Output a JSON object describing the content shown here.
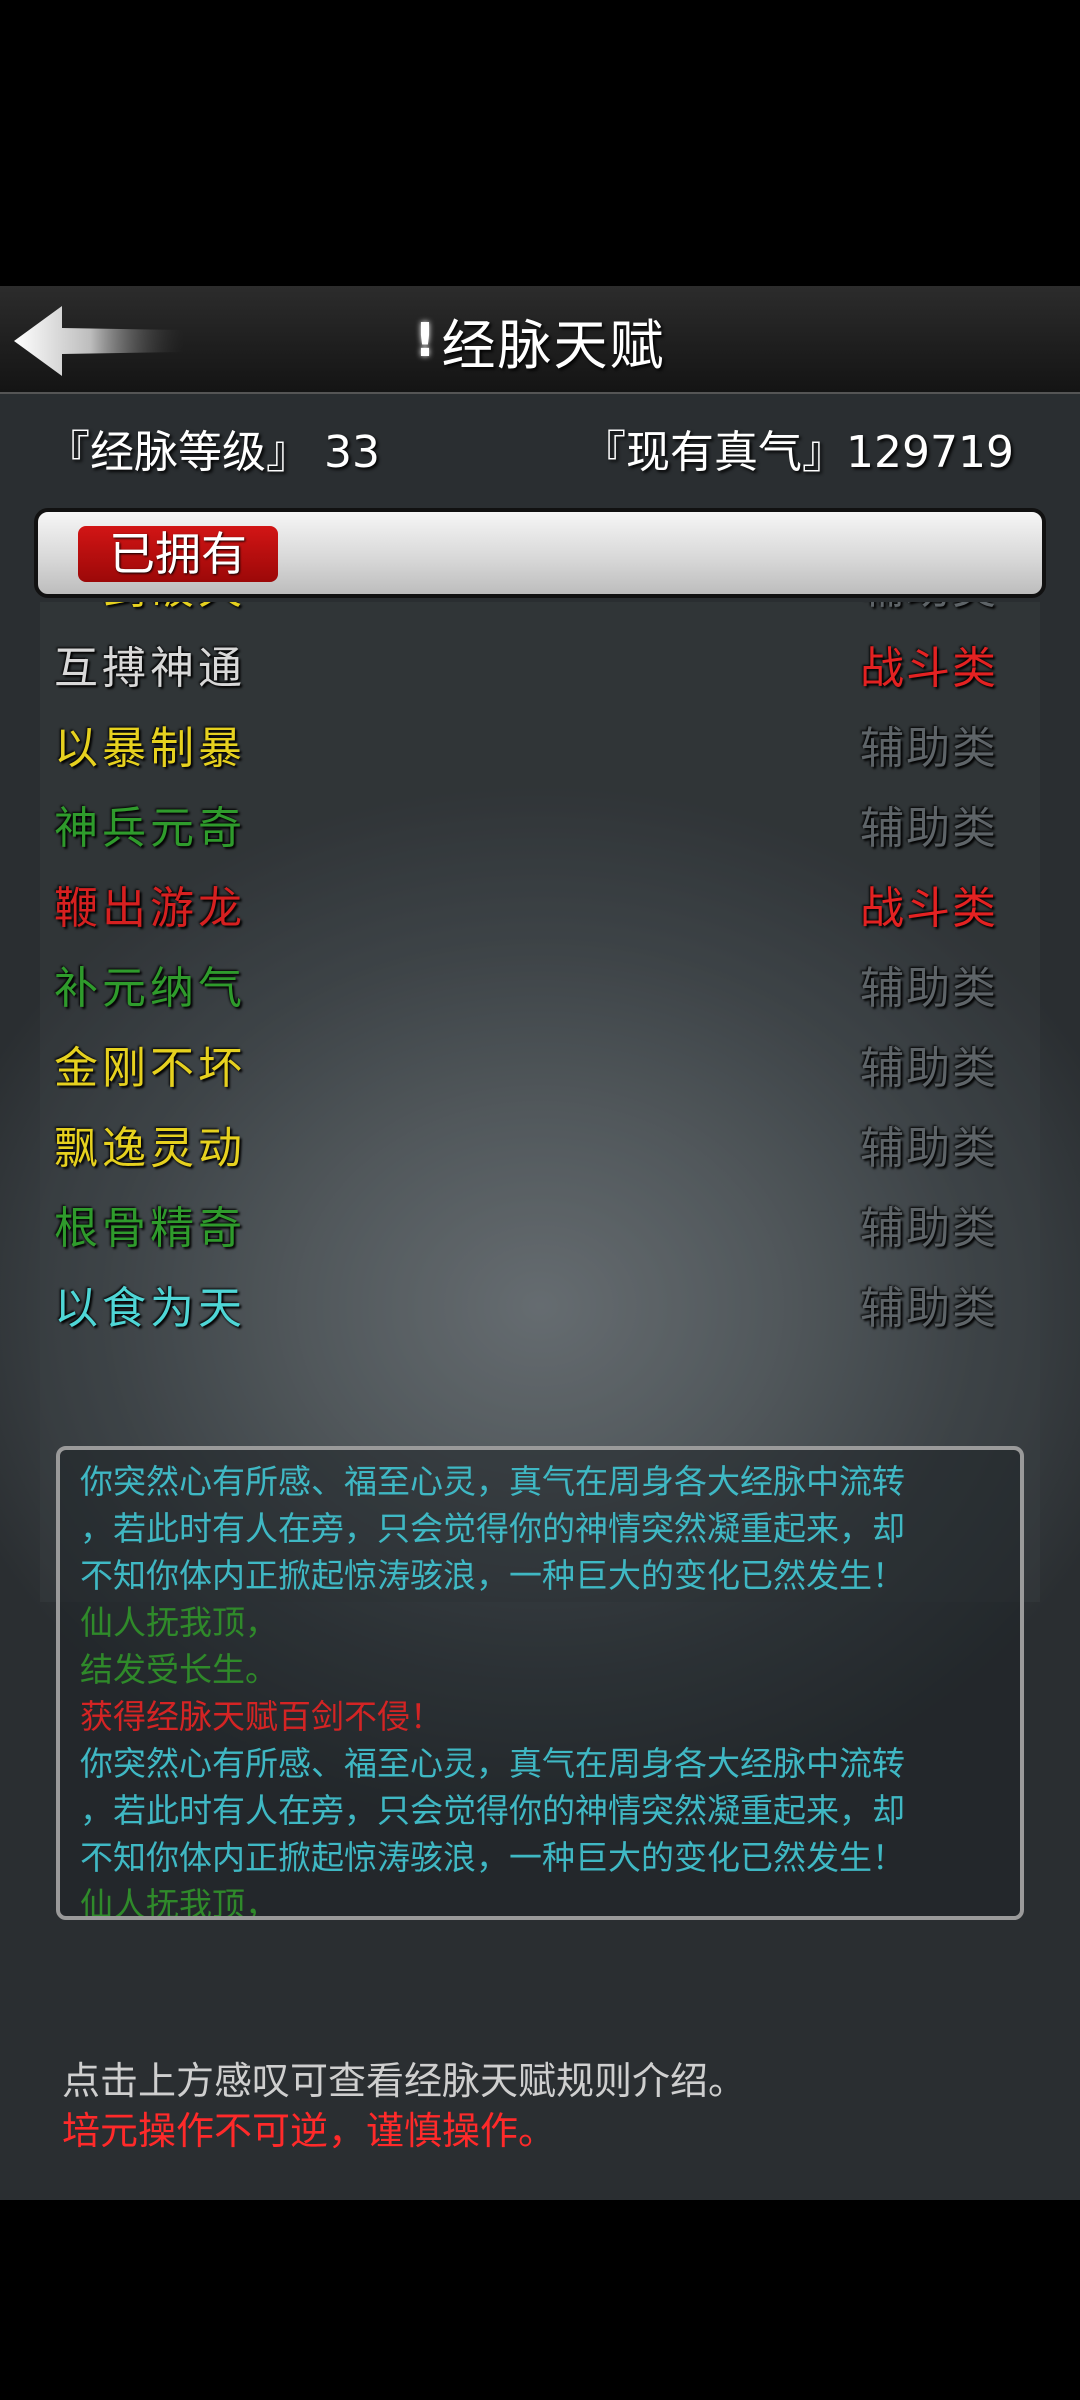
{
  "header": {
    "title": "经脉天赋",
    "info": "!"
  },
  "stats": {
    "level_label": "『经脉等级』 33",
    "qi_label": "『现有真气』129719"
  },
  "tab": {
    "owned": "已拥有"
  },
  "talents": [
    {
      "name": "一剑破天",
      "category": "辅助类",
      "name_color": "#e6d11f",
      "cat_color": "#5e6468"
    },
    {
      "name": "互搏神通",
      "category": "战斗类",
      "name_color": "#d8d8d8",
      "cat_color": "#e32222"
    },
    {
      "name": "以暴制暴",
      "category": "辅助类",
      "name_color": "#e6d11f",
      "cat_color": "#5e6468"
    },
    {
      "name": "神兵元奇",
      "category": "辅助类",
      "name_color": "#2f9b2c",
      "cat_color": "#5e6468"
    },
    {
      "name": "鞭出游龙",
      "category": "战斗类",
      "name_color": "#d62020",
      "cat_color": "#e32222"
    },
    {
      "name": "补元纳气",
      "category": "辅助类",
      "name_color": "#2f9b2c",
      "cat_color": "#5e6468"
    },
    {
      "name": "金刚不坏",
      "category": "辅助类",
      "name_color": "#e6d11f",
      "cat_color": "#5e6468"
    },
    {
      "name": "飘逸灵动",
      "category": "辅助类",
      "name_color": "#e6d11f",
      "cat_color": "#5e6468"
    },
    {
      "name": "根骨精奇",
      "category": "辅助类",
      "name_color": "#2f9b2c",
      "cat_color": "#5e6468"
    },
    {
      "name": "以食为天",
      "category": "辅助类",
      "name_color": "#4fd6d6",
      "cat_color": "#5e6468"
    }
  ],
  "log": [
    {
      "text": "你突然心有所感、福至心灵，真气在周身各大经脉中流转",
      "color": "#3fb8c4"
    },
    {
      "text": "，若此时有人在旁，只会觉得你的神情突然凝重起来，却",
      "color": "#3fb8c4"
    },
    {
      "text": "不知你体内正掀起惊涛骇浪，一种巨大的变化已然发生！",
      "color": "#3fb8c4"
    },
    {
      "text": "仙人抚我顶，",
      "color": "#2f8a2a"
    },
    {
      "text": "结发受长生。",
      "color": "#2f8a2a"
    },
    {
      "text": "获得经脉天赋百剑不侵！",
      "color": "#d42424"
    },
    {
      "text": "你突然心有所感、福至心灵，真气在周身各大经脉中流转",
      "color": "#3fb8c4"
    },
    {
      "text": "，若此时有人在旁，只会觉得你的神情突然凝重起来，却",
      "color": "#3fb8c4"
    },
    {
      "text": "不知你体内正掀起惊涛骇浪，一种巨大的变化已然发生！",
      "color": "#3fb8c4"
    },
    {
      "text": "仙人抚我顶，",
      "color": "#2f8a2a"
    }
  ],
  "footer": {
    "hint": "点击上方感叹可查看经脉天赋规则介绍。",
    "warning": "培元操作不可逆，谨慎操作。"
  }
}
